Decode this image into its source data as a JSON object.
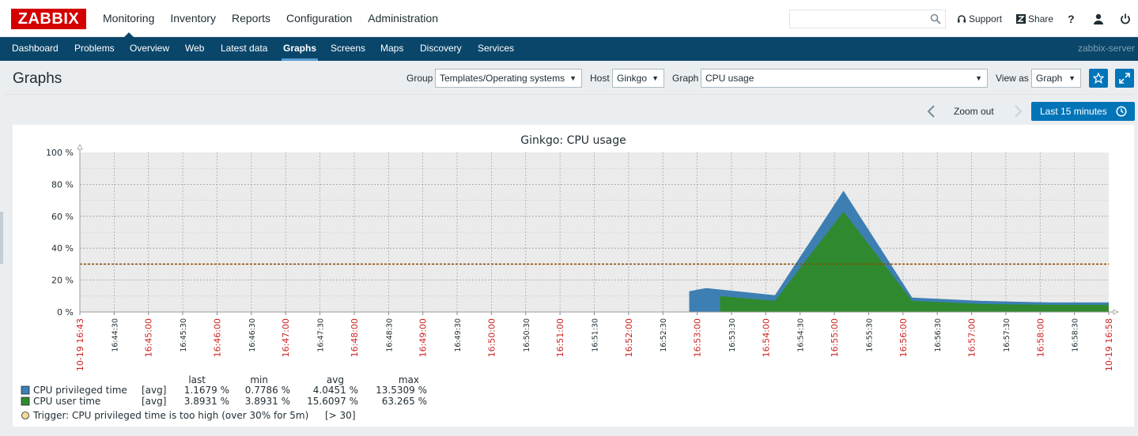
{
  "app": {
    "logo": "ZABBIX"
  },
  "main_menu": [
    "Monitoring",
    "Inventory",
    "Reports",
    "Configuration",
    "Administration"
  ],
  "main_menu_active": "Monitoring",
  "search": {
    "value": "",
    "placeholder": ""
  },
  "top_links": {
    "support": "Support",
    "share": "Share",
    "help": "?"
  },
  "sub_menu": [
    "Dashboard",
    "Problems",
    "Overview",
    "Web",
    "Latest data",
    "Graphs",
    "Screens",
    "Maps",
    "Discovery",
    "Services"
  ],
  "sub_menu_active": "Graphs",
  "server_name": "zabbix-server",
  "page": {
    "title": "Graphs"
  },
  "filters": {
    "group_label": "Group",
    "group_value": "Templates/Operating systems",
    "host_label": "Host",
    "host_value": "Ginkgo",
    "graph_label": "Graph",
    "graph_value": "CPU usage",
    "view_label": "View as",
    "view_value": "Graph"
  },
  "zoom": {
    "zoom_out": "Zoom out",
    "period": "Last 15 minutes"
  },
  "colors": {
    "accent": "#0275b8",
    "nav": "#0a466a",
    "privileged": "#3d7fb3",
    "user": "#2f8a2f",
    "trigger": "#8b4a00",
    "label_red": "#cc2222"
  },
  "chart_data": {
    "type": "area",
    "title": "Ginkgo: CPU usage",
    "ylim": [
      0,
      100
    ],
    "y_ticks": [
      "0 %",
      "20 %",
      "40 %",
      "60 %",
      "80 %",
      "100 %"
    ],
    "x_tick_labels": [
      {
        "label": "10-19 16:43",
        "red": true
      },
      {
        "label": "16:44:30",
        "red": false
      },
      {
        "label": "16:45:00",
        "red": true
      },
      {
        "label": "16:45:30",
        "red": false
      },
      {
        "label": "16:46:00",
        "red": true
      },
      {
        "label": "16:46:30",
        "red": false
      },
      {
        "label": "16:47:00",
        "red": true
      },
      {
        "label": "16:47:30",
        "red": false
      },
      {
        "label": "16:48:00",
        "red": true
      },
      {
        "label": "16:48:30",
        "red": false
      },
      {
        "label": "16:49:00",
        "red": true
      },
      {
        "label": "16:49:30",
        "red": false
      },
      {
        "label": "16:50:00",
        "red": true
      },
      {
        "label": "16:50:30",
        "red": false
      },
      {
        "label": "16:51:00",
        "red": true
      },
      {
        "label": "16:51:30",
        "red": false
      },
      {
        "label": "16:52:00",
        "red": true
      },
      {
        "label": "16:52:30",
        "red": false
      },
      {
        "label": "16:53:00",
        "red": true
      },
      {
        "label": "16:53:30",
        "red": false
      },
      {
        "label": "16:54:00",
        "red": true
      },
      {
        "label": "16:54:30",
        "red": false
      },
      {
        "label": "16:55:00",
        "red": true
      },
      {
        "label": "16:55:30",
        "red": false
      },
      {
        "label": "16:56:00",
        "red": true
      },
      {
        "label": "16:56:30",
        "red": false
      },
      {
        "label": "16:57:00",
        "red": true
      },
      {
        "label": "16:57:30",
        "red": false
      },
      {
        "label": "16:58:00",
        "red": true
      },
      {
        "label": "16:58:30",
        "red": false
      },
      {
        "label": "10-19 16:58",
        "red": true
      }
    ],
    "series": [
      {
        "name": "CPU privileged time",
        "color": "#3d7fb3",
        "points": [
          {
            "t": "16:52:52",
            "y": 13.0
          },
          {
            "t": "16:53:07",
            "y": 15.0
          },
          {
            "t": "16:54:07",
            "y": 10.5
          },
          {
            "t": "16:55:07",
            "y": 76.0
          },
          {
            "t": "16:56:07",
            "y": 9.0
          },
          {
            "t": "16:57:07",
            "y": 7.0
          },
          {
            "t": "16:58:07",
            "y": 6.0
          },
          {
            "t": "16:58:59",
            "y": 6.0
          }
        ]
      },
      {
        "name": "CPU user time",
        "color": "#2f8a2f",
        "points": [
          {
            "t": "16:53:19",
            "y": 10.0
          },
          {
            "t": "16:54:07",
            "y": 7.0
          },
          {
            "t": "16:55:07",
            "y": 63.0
          },
          {
            "t": "16:56:07",
            "y": 7.0
          },
          {
            "t": "16:57:07",
            "y": 5.0
          },
          {
            "t": "16:58:07",
            "y": 4.5
          },
          {
            "t": "16:58:59",
            "y": 4.5
          }
        ]
      }
    ],
    "trigger_line": 30,
    "legend": {
      "headers": [
        "last",
        "min",
        "avg",
        "max"
      ],
      "rows": [
        {
          "name": "CPU privileged time",
          "func": "[avg]",
          "last": "1.1679 %",
          "min": "0.7786 %",
          "avg": "4.0451 %",
          "max": "13.5309 %",
          "color": "#3d7fb3"
        },
        {
          "name": "CPU user time",
          "func": "[avg]",
          "last": "3.8931 %",
          "min": "3.8931 %",
          "avg": "15.6097 %",
          "max": "63.265 %",
          "color": "#2f8a2f"
        }
      ],
      "trigger": "Trigger: CPU privileged time is too high (over 30% for 5m)",
      "trigger_value": "[> 30]"
    }
  }
}
